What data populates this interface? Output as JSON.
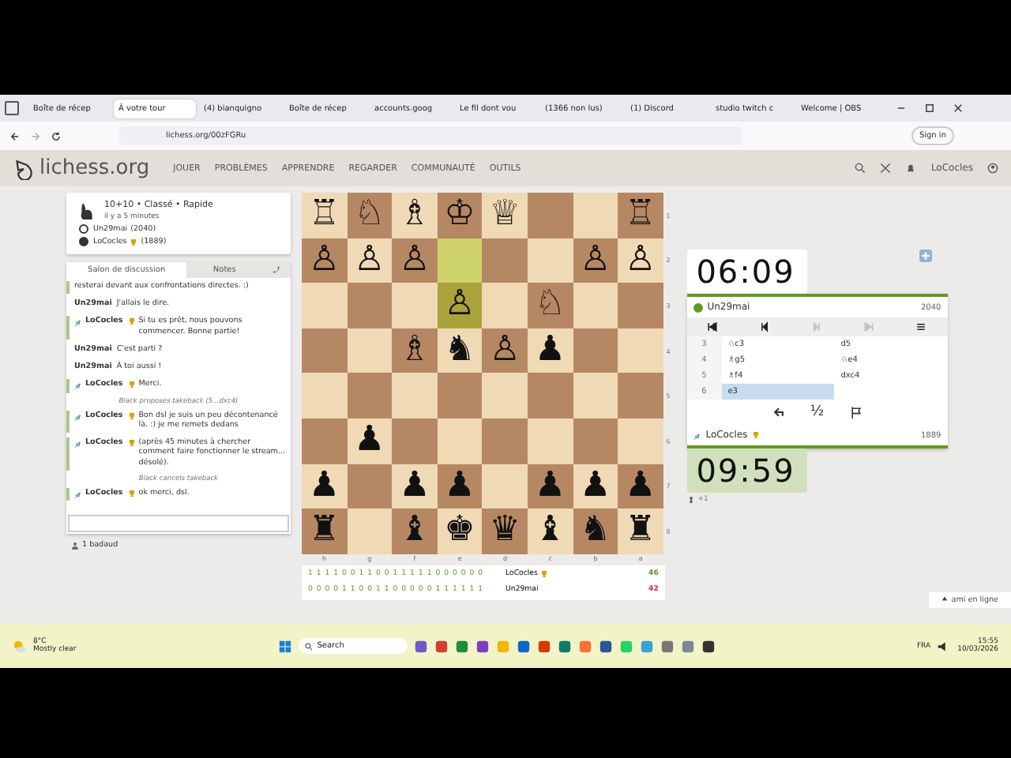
{
  "browser": {
    "tabs": [
      {
        "label": "Boîte de récep",
        "selected": false
      },
      {
        "label": "À votre tour",
        "selected": true
      },
      {
        "label": "(4) bianquigno",
        "selected": false
      },
      {
        "label": "Boîte de récep",
        "selected": false
      },
      {
        "label": "accounts.goog",
        "selected": false
      },
      {
        "label": "Le fil dont vou",
        "selected": false
      },
      {
        "label": "(1366 non lus)",
        "selected": false
      },
      {
        "label": "(1) Discord",
        "selected": false
      },
      {
        "label": "studio twitch c",
        "selected": false
      },
      {
        "label": "Welcome | OBS",
        "selected": false
      }
    ],
    "url": "lichess.org/00zFGRu",
    "sign_in": "Sign in"
  },
  "site": {
    "logo": "lichess.org",
    "nav": [
      "JOUER",
      "PROBLÈMES",
      "APPRENDRE",
      "REGARDER",
      "COMMUNAUTÉ",
      "OUTILS"
    ],
    "user": "LoCocles"
  },
  "game_info": {
    "title": "10+10 • Classé • Rapide",
    "time": "il y a 5 minutes",
    "players": [
      {
        "name": "Un29mai",
        "rating": "(2040)",
        "white": true,
        "trophy": false
      },
      {
        "name": "LoCocles",
        "rating": "(1889)",
        "white": false,
        "trophy": true
      }
    ]
  },
  "chat": {
    "tabs": [
      {
        "label": "Salon de discussion",
        "selected": true
      },
      {
        "label": "Notes",
        "selected": false
      }
    ],
    "messages": [
      {
        "kind": "fragment",
        "own": true,
        "text": "resterai devant aux confrontations directes. :)"
      },
      {
        "kind": "message",
        "own": false,
        "user": "Un29mai",
        "text": "J'allais le dire."
      },
      {
        "kind": "message",
        "own": true,
        "user": "LoCocles",
        "text": "Si tu es prêt, nous pouvons commencer. Bonne partie!"
      },
      {
        "kind": "message",
        "own": false,
        "user": "Un29mai",
        "text": "C'est parti ?"
      },
      {
        "kind": "message",
        "own": false,
        "user": "Un29mai",
        "text": "À toi aussi !"
      },
      {
        "kind": "message",
        "own": true,
        "user": "LoCocles",
        "text": "Merci."
      },
      {
        "kind": "system",
        "text": "Black proposes takeback (5...dxc4)"
      },
      {
        "kind": "message",
        "own": true,
        "user": "LoCocles",
        "text": "Bon dsl je suis un peu décontenancé là. :) je me remets dedans"
      },
      {
        "kind": "message",
        "own": true,
        "user": "LoCocles",
        "text": "(après 45 minutes à chercher comment faire fonctionner le stream... désolé)."
      },
      {
        "kind": "system",
        "text": "Black cancels takeback"
      },
      {
        "kind": "message",
        "own": true,
        "user": "LoCocles",
        "text": "ok merci, dsl."
      }
    ],
    "spectators": "1 badaud"
  },
  "board": {
    "ranks": [
      "1",
      "2",
      "3",
      "4",
      "5",
      "6",
      "7",
      "8"
    ],
    "files": [
      "h",
      "g",
      "f",
      "e",
      "d",
      "c",
      "b",
      "a"
    ],
    "rows": [
      [
        {
          "piece": "♖",
          "highlighted": false
        },
        {
          "piece": "♘",
          "highlighted": false
        },
        {
          "piece": "♗",
          "highlighted": false
        },
        {
          "piece": "♔",
          "highlighted": false
        },
        {
          "piece": "♕",
          "highlighted": false
        },
        {
          "highlighted": false
        },
        {
          "highlighted": false
        },
        {
          "piece": "♖",
          "highlighted": false
        }
      ],
      [
        {
          "piece": "♙",
          "highlighted": false
        },
        {
          "piece": "♙",
          "highlighted": false
        },
        {
          "piece": "♙",
          "highlighted": false
        },
        {
          "highlighted": true
        },
        {
          "highlighted": false
        },
        {
          "highlighted": false
        },
        {
          "piece": "♙",
          "highlighted": false
        },
        {
          "piece": "♙",
          "highlighted": false
        }
      ],
      [
        {
          "highlighted": false
        },
        {
          "highlighted": false
        },
        {
          "highlighted": false
        },
        {
          "piece": "♙",
          "highlighted": true
        },
        {
          "highlighted": false
        },
        {
          "piece": "♘",
          "highlighted": false
        },
        {
          "highlighted": false
        },
        {
          "highlighted": false
        }
      ],
      [
        {
          "highlighted": false
        },
        {
          "highlighted": false
        },
        {
          "piece": "♗",
          "highlighted": false
        },
        {
          "piece": "♞",
          "highlighted": false
        },
        {
          "piece": "♙",
          "highlighted": false
        },
        {
          "piece": "♟",
          "highlighted": false
        },
        {
          "highlighted": false
        },
        {
          "highlighted": false
        }
      ],
      [
        {
          "highlighted": false
        },
        {
          "highlighted": false
        },
        {
          "highlighted": false
        },
        {
          "highlighted": false
        },
        {
          "highlighted": false
        },
        {
          "highlighted": false
        },
        {
          "highlighted": false
        },
        {
          "highlighted": false
        }
      ],
      [
        {
          "highlighted": false
        },
        {
          "piece": "♟",
          "highlighted": false
        },
        {
          "highlighted": false
        },
        {
          "highlighted": false
        },
        {
          "highlighted": false
        },
        {
          "highlighted": false
        },
        {
          "highlighted": false
        },
        {
          "highlighted": false
        }
      ],
      [
        {
          "piece": "♟",
          "highlighted": false
        },
        {
          "highlighted": false
        },
        {
          "piece": "♟",
          "highlighted": false
        },
        {
          "piece": "♟",
          "highlighted": false
        },
        {
          "highlighted": false
        },
        {
          "piece": "♟",
          "highlighted": false
        },
        {
          "piece": "♟",
          "highlighted": false
        },
        {
          "piece": "♟",
          "highlighted": false
        }
      ],
      [
        {
          "piece": "♜",
          "highlighted": false
        },
        {
          "highlighted": false
        },
        {
          "piece": "♝",
          "highlighted": false
        },
        {
          "piece": "♚",
          "highlighted": false
        },
        {
          "piece": "♛",
          "highlighted": false
        },
        {
          "piece": "♝",
          "highlighted": false
        },
        {
          "piece": "♞",
          "highlighted": false
        },
        {
          "piece": "♜",
          "highlighted": false
        }
      ]
    ]
  },
  "scores": [
    {
      "results": "1 1 1 1 0 0 1 1 0 0 1 1 1 1 1 0 0 0 0 0 0",
      "name": "LoCocles",
      "trophy": true,
      "total": "46",
      "color": "#629924"
    },
    {
      "results": "0 0 0 0 1 1 0 0 1 1 0 0 0 0 0 1 1 1 1 1 1",
      "name": "Un29mai",
      "trophy": false,
      "total": "42",
      "color": "#cc3333"
    }
  ],
  "opponent": {
    "clock": "06:09",
    "running": false,
    "name": "Un29mai",
    "rating": "2040",
    "online": true
  },
  "controls": [
    {
      "kind": "first",
      "disabled": false
    },
    {
      "kind": "prev",
      "disabled": false
    },
    {
      "kind": "next",
      "disabled": true
    },
    {
      "kind": "last",
      "disabled": true
    },
    {
      "kind": "menu",
      "disabled": false
    }
  ],
  "moves": [
    {
      "number": "3",
      "white": {
        "san": "♘c3",
        "selected": false
      },
      "black": {
        "san": "d5",
        "selected": false
      }
    },
    {
      "number": "4",
      "white": {
        "san": "♗g5",
        "selected": false
      },
      "black": {
        "san": "♘e4",
        "selected": false
      }
    },
    {
      "number": "5",
      "white": {
        "san": "♗f4",
        "selected": false
      },
      "black": {
        "san": "dxc4",
        "selected": false
      }
    },
    {
      "number": "6",
      "white": {
        "san": "e3",
        "selected": true
      }
    }
  ],
  "actions": {
    "draw": "½"
  },
  "me": {
    "clock": "09:59",
    "running": true,
    "name": "LoCocles",
    "trophy": true,
    "rating": "1889",
    "material": "+1"
  },
  "friends": "ami en ligne",
  "taskbar": {
    "temperature": "8°C",
    "weather": "Mostly clear",
    "search": "Search",
    "language": "FRA",
    "time": "15:55",
    "date": "10/03/2026"
  }
}
